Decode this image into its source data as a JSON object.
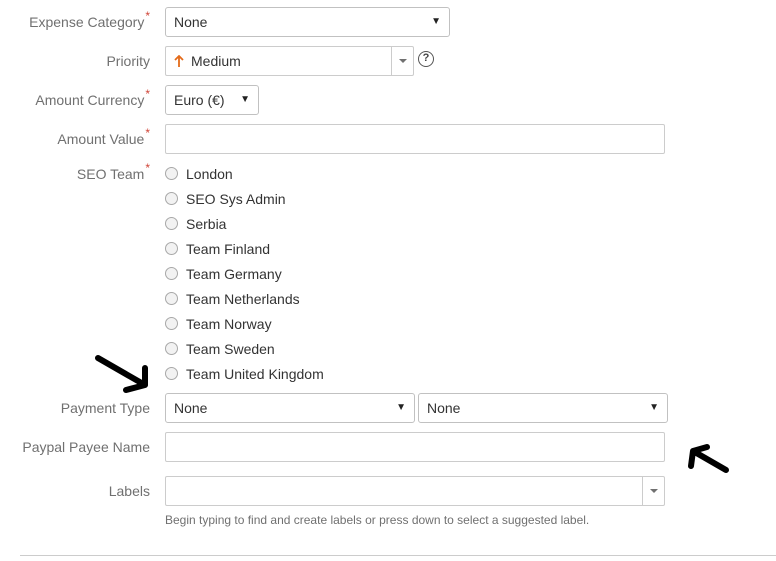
{
  "form": {
    "expense_category": {
      "label": "Expense Category",
      "required": "*",
      "value": "None"
    },
    "priority": {
      "label": "Priority",
      "value": "Medium",
      "help": "?"
    },
    "amount_currency": {
      "label": "Amount Currency",
      "required": "*",
      "value": "Euro (€)"
    },
    "amount_value": {
      "label": "Amount Value",
      "required": "*",
      "value": ""
    },
    "seo_team": {
      "label": "SEO Team",
      "required": "*",
      "options": [
        "London",
        "SEO Sys Admin",
        "Serbia",
        "Team Finland",
        "Team Germany",
        "Team Netherlands",
        "Team Norway",
        "Team Sweden",
        "Team United Kingdom"
      ]
    },
    "payment_type": {
      "label": "Payment Type",
      "value_1": "None",
      "value_2": "None"
    },
    "paypal_payee_name": {
      "label": "Paypal Payee Name",
      "value": ""
    },
    "labels": {
      "label": "Labels",
      "value": "",
      "description": "Begin typing to find and create labels or press down to select a suggested label."
    }
  },
  "colors": {
    "required": "#d04437",
    "label": "#707070",
    "priority_arrow": "#e46b1a",
    "annotation": "#000000"
  },
  "icons": {
    "priority": "arrow-up-icon",
    "help": "question-circle-icon",
    "caret": "caret-down-icon"
  }
}
